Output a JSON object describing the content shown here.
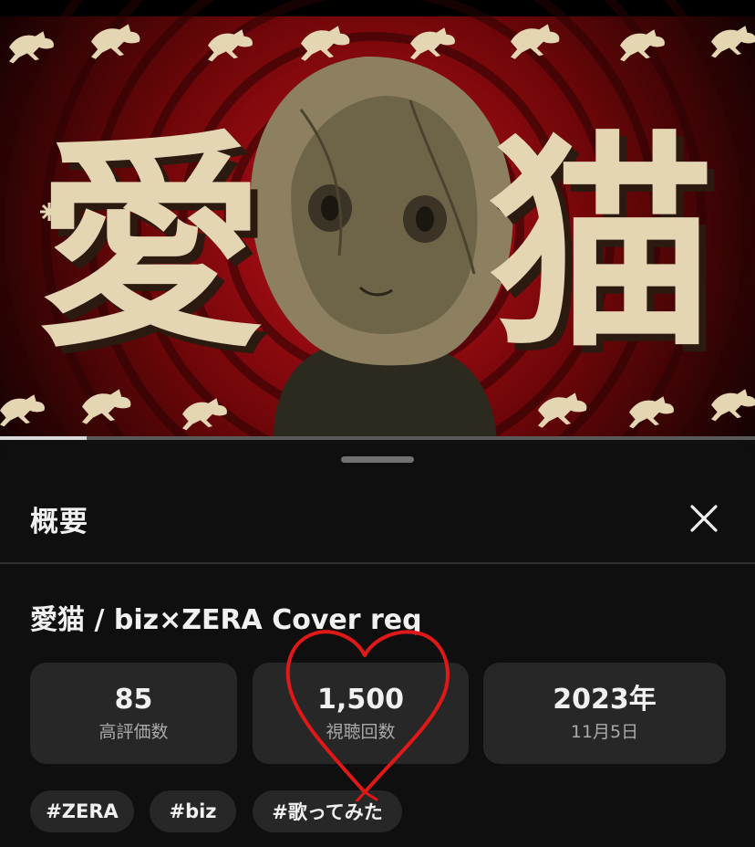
{
  "thumbnail": {
    "title_chars": [
      "愛",
      "猫"
    ],
    "colors": {
      "bg_center": "#c2101a",
      "bg_edge": "#120202",
      "cream": "#e4d6b3",
      "shadow": "#2a1a10"
    },
    "progress": 0.115
  },
  "sheet": {
    "title": "概要",
    "close_icon": "close-icon"
  },
  "video": {
    "title": "愛猫 / biz×ZERA Cover req"
  },
  "stats": [
    {
      "value": "85",
      "label": "高評価数"
    },
    {
      "value": "1,500",
      "label": "視聴回数"
    },
    {
      "value": "2023年",
      "label": "11月5日"
    }
  ],
  "tags": [
    "#ZERA",
    "#biz",
    "#歌ってみた"
  ],
  "annotation": {
    "icon": "heart-doodle-icon",
    "color": "#e01818"
  }
}
